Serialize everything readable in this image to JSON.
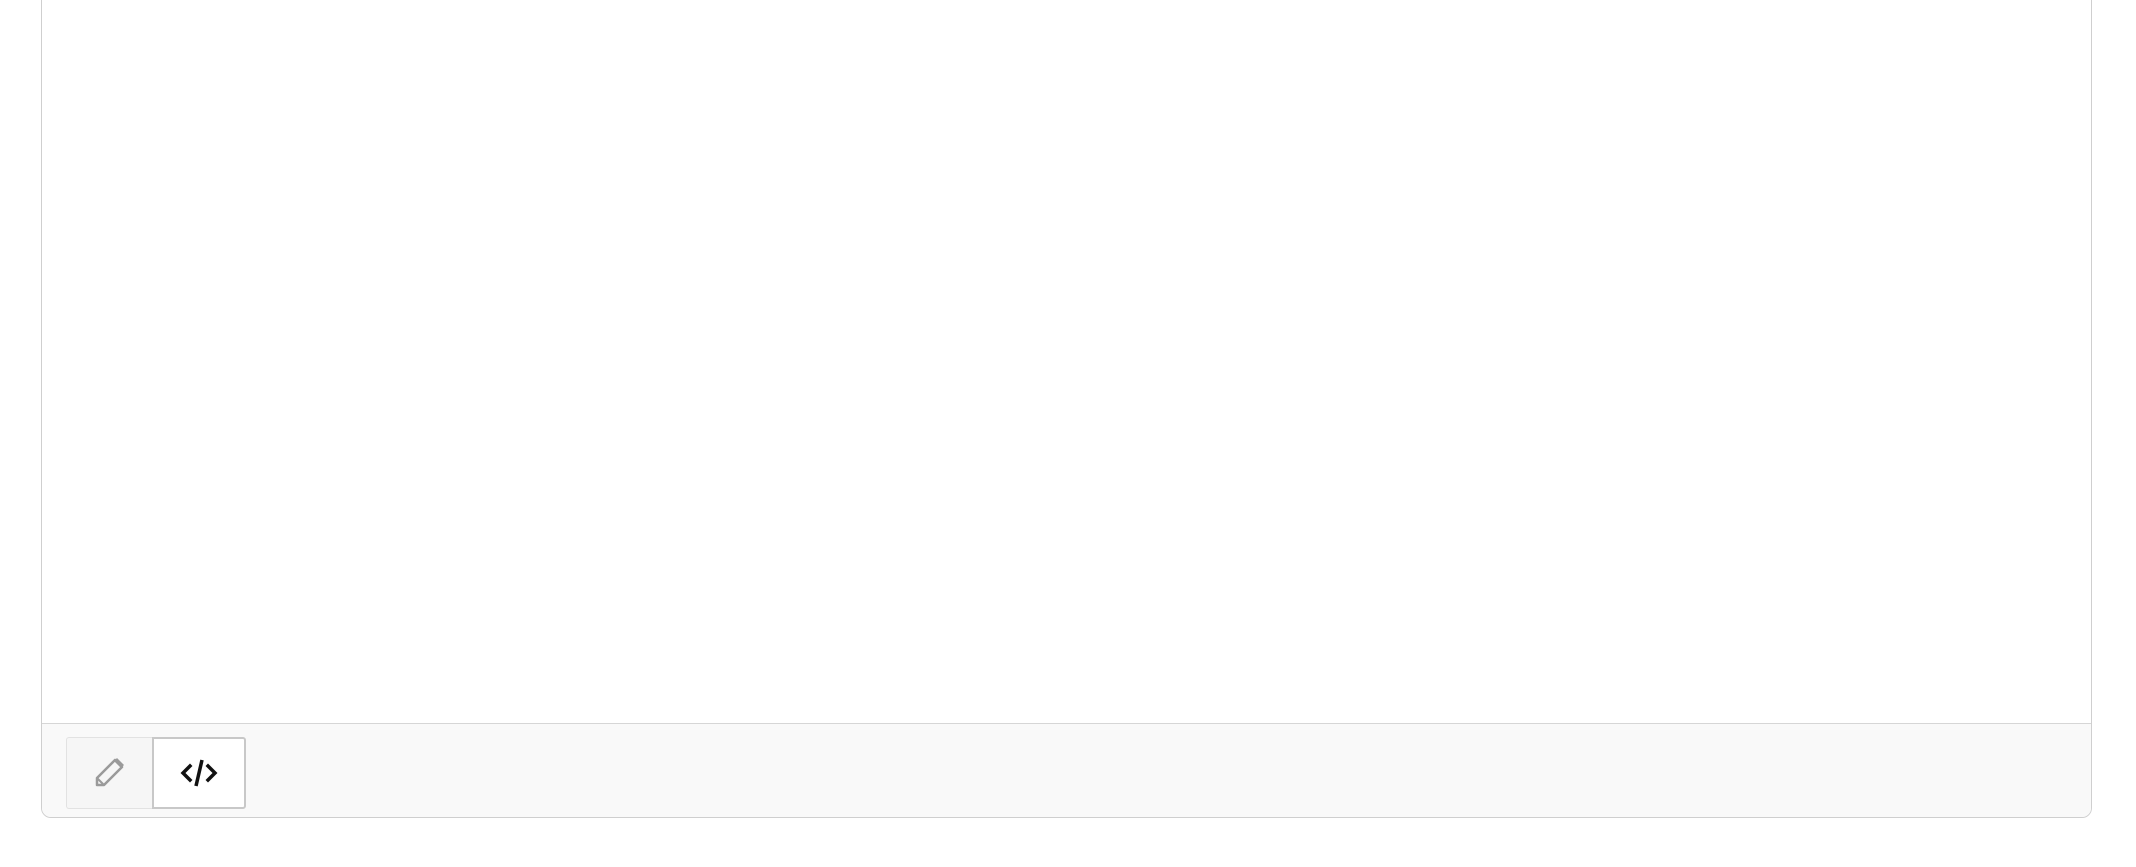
{
  "editor": {
    "content": "",
    "toolbar": {
      "modes": [
        {
          "id": "wysiwyg",
          "label": "Visual",
          "icon": "pencil-icon",
          "active": false
        },
        {
          "id": "source",
          "label": "Source",
          "icon": "code-icon",
          "active": true
        }
      ]
    },
    "colors": {
      "border": "#cfcfcf",
      "toolbar_bg": "#f9f9f9",
      "icon_inactive": "#9a9a9a",
      "icon_active": "#111111"
    }
  }
}
